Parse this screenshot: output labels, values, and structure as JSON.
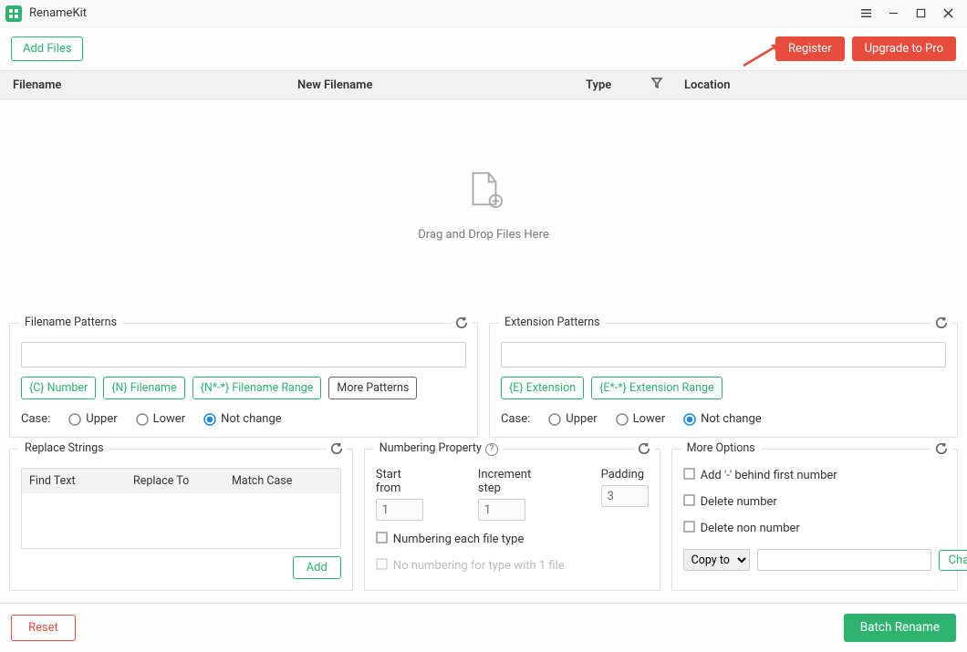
{
  "titlebar": {
    "app_name": "RenameKit"
  },
  "topbar": {
    "add_files": "Add Files",
    "register": "Register",
    "upgrade": "Upgrade to Pro"
  },
  "table": {
    "columns": {
      "filename": "Filename",
      "new_filename": "New Filename",
      "type": "Type",
      "location": "Location"
    }
  },
  "dropzone": {
    "text": "Drag and Drop Files Here"
  },
  "filename_patterns": {
    "legend": "Filename Patterns",
    "tokens": {
      "c_number": "{C} Number",
      "n_filename": "{N} Filename",
      "n_range": "{N*-*} Filename Range",
      "more": "More Patterns"
    },
    "case": {
      "label": "Case:",
      "upper": "Upper",
      "lower": "Lower",
      "not_change": "Not change"
    }
  },
  "extension_patterns": {
    "legend": "Extension Patterns",
    "tokens": {
      "e_ext": "{E} Extension",
      "e_range": "{E*-*} Extension Range"
    },
    "case": {
      "label": "Case:",
      "upper": "Upper",
      "lower": "Lower",
      "not_change": "Not change"
    }
  },
  "replace": {
    "legend": "Replace Strings",
    "columns": {
      "find": "Find Text",
      "replace_to": "Replace To",
      "match_case": "Match Case"
    },
    "add": "Add"
  },
  "numbering": {
    "legend": "Numbering Property",
    "start_from_label": "Start from",
    "start_from": "1",
    "increment_label": "Increment step",
    "increment": "1",
    "padding_label": "Padding",
    "padding": "3",
    "each_type": "Numbering each file type",
    "no_numbering_1file": "No numbering for type with 1 file"
  },
  "more_options": {
    "legend": "More Options",
    "add_dash": "Add '-' behind first number",
    "delete_number": "Delete number",
    "delete_non_number": "Delete non number",
    "copy_to": "Copy to",
    "change": "Change"
  },
  "footer": {
    "reset": "Reset",
    "batch_rename": "Batch Rename"
  }
}
